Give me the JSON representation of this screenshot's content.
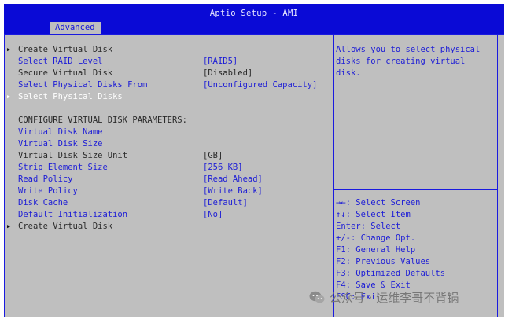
{
  "header": {
    "title": "Aptio Setup - AMI",
    "tab": "Advanced"
  },
  "menu": [
    {
      "label": "Create Virtual Disk",
      "value": "",
      "style": "dark",
      "arrow": true
    },
    {
      "label": "Select RAID Level",
      "value": "[RAID5]",
      "style": "blue",
      "arrow": false
    },
    {
      "label": "Secure Virtual Disk",
      "value": "[Disabled]",
      "style": "dark",
      "arrow": false
    },
    {
      "label": "Select Physical Disks From",
      "value": "[Unconfigured Capacity]",
      "style": "blue",
      "arrow": false
    },
    {
      "label": "Select Physical Disks",
      "value": "",
      "style": "white",
      "arrow": true
    },
    {
      "label": "",
      "value": "",
      "style": "dark",
      "arrow": false
    },
    {
      "label": "CONFIGURE VIRTUAL DISK PARAMETERS:",
      "value": "",
      "style": "dark",
      "arrow": false
    },
    {
      "label": "Virtual Disk Name",
      "value": "",
      "style": "blue",
      "arrow": false
    },
    {
      "label": "Virtual Disk Size",
      "value": "",
      "style": "blue",
      "arrow": false
    },
    {
      "label": "Virtual Disk Size Unit",
      "value": "[GB]",
      "style": "dark",
      "arrow": false
    },
    {
      "label": "Strip Element Size",
      "value": "[256 KB]",
      "style": "blue",
      "arrow": false
    },
    {
      "label": "Read Policy",
      "value": "[Read Ahead]",
      "style": "blue",
      "arrow": false
    },
    {
      "label": "Write Policy",
      "value": "[Write Back]",
      "style": "blue",
      "arrow": false
    },
    {
      "label": "Disk Cache",
      "value": "[Default]",
      "style": "blue",
      "arrow": false
    },
    {
      "label": "Default Initialization",
      "value": "[No]",
      "style": "blue",
      "arrow": false
    },
    {
      "label": "Create Virtual Disk",
      "value": "",
      "style": "dark",
      "arrow": true
    }
  ],
  "help": {
    "text": "Allows you to select physical\ndisks for creating virtual\ndisk.",
    "keys": [
      "→←: Select Screen",
      "↑↓: Select Item",
      "Enter: Select",
      "+/-: Change Opt.",
      "F1: General Help",
      "F2: Previous Values",
      "F3: Optimized Defaults",
      "F4: Save & Exit",
      "ESC: Exit"
    ]
  },
  "watermark": {
    "text": "公众号 · 运维李哥不背锅",
    "icon": "wechat-icon"
  },
  "colors": {
    "header_bg": "#0a0ad6",
    "panel_bg": "#bfbfbf",
    "item_blue": "#1d1dd6",
    "selected": "#ffffff"
  }
}
